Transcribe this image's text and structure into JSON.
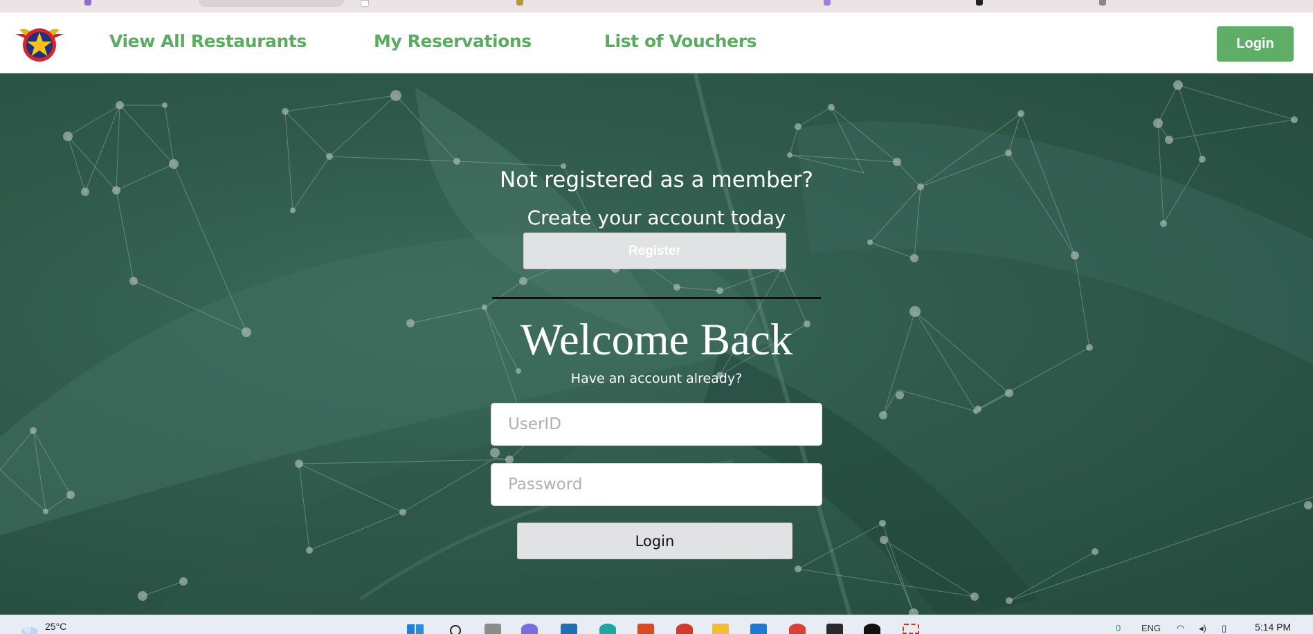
{
  "nav": {
    "logo": "captain-marvel-star-logo",
    "links": [
      "View All Restaurants",
      "My Reservations",
      "List of Vouchers"
    ],
    "login_label": "Login"
  },
  "register_section": {
    "prompt": "Not registered as a member?",
    "subprompt": "Create your account today",
    "button_label": "Register"
  },
  "login_section": {
    "heading": "Welcome Back",
    "subheading": "Have an account already?",
    "userid_placeholder": "UserID",
    "password_placeholder": "Password",
    "button_label": "Login"
  },
  "taskbar": {
    "temperature": "25°C",
    "language": "ENG",
    "notification_count": "0",
    "time": "5:14 PM"
  },
  "colors": {
    "nav_accent": "#5cab63",
    "hero_background": "#2f5a4b"
  }
}
